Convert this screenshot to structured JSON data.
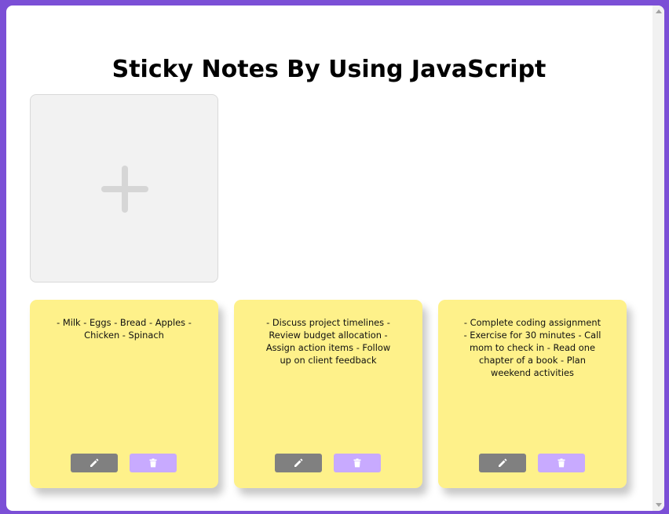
{
  "page": {
    "title": "Sticky Notes By Using JavaScript"
  },
  "add_note": {
    "icon": "plus-icon"
  },
  "notes": [
    {
      "text": "- Milk - Eggs - Bread - Apples - Chicken - Spinach",
      "edit_icon": "pencil-icon",
      "delete_icon": "trash-icon"
    },
    {
      "text": "- Discuss project timelines - Review budget allocation - Assign action items - Follow up on client feedback",
      "edit_icon": "pencil-icon",
      "delete_icon": "trash-icon"
    },
    {
      "text": "- Complete coding assignment - Exercise for 30 minutes - Call mom to check in - Read one chapter of a book - Plan weekend activities",
      "edit_icon": "pencil-icon",
      "delete_icon": "trash-icon"
    }
  ],
  "colors": {
    "frame": "#7b4fd6",
    "note_background": "#fef18a",
    "edit_button": "#808080",
    "delete_button": "#c8aaff",
    "add_tile": "#f2f2f2"
  }
}
